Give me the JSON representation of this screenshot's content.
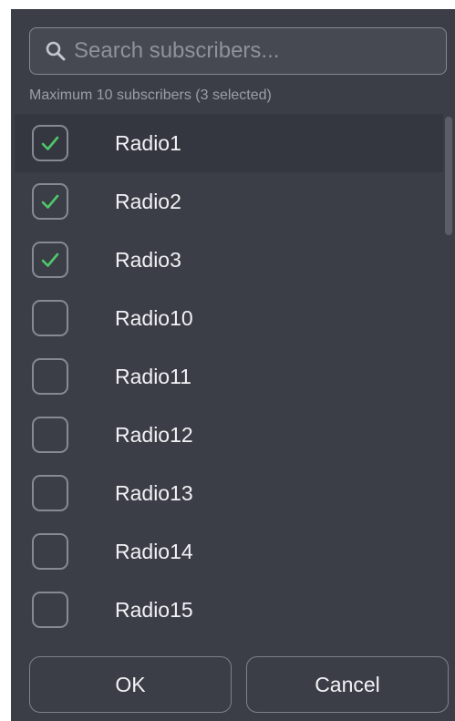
{
  "search": {
    "placeholder": "Search subscribers...",
    "icon": "search-icon"
  },
  "helper_text": "Maximum 10 subscribers (3 selected)",
  "subscribers": [
    {
      "label": "Radio1",
      "checked": true,
      "highlighted": true
    },
    {
      "label": "Radio2",
      "checked": true,
      "highlighted": false
    },
    {
      "label": "Radio3",
      "checked": true,
      "highlighted": false
    },
    {
      "label": "Radio10",
      "checked": false,
      "highlighted": false
    },
    {
      "label": "Radio11",
      "checked": false,
      "highlighted": false
    },
    {
      "label": "Radio12",
      "checked": false,
      "highlighted": false
    },
    {
      "label": "Radio13",
      "checked": false,
      "highlighted": false
    },
    {
      "label": "Radio14",
      "checked": false,
      "highlighted": false
    },
    {
      "label": "Radio15",
      "checked": false,
      "highlighted": false
    }
  ],
  "buttons": {
    "ok_label": "OK",
    "cancel_label": "Cancel"
  },
  "colors": {
    "panel_bg": "#3c3e47",
    "check_green": "#4ec86a",
    "text": "#f1f2f5"
  }
}
